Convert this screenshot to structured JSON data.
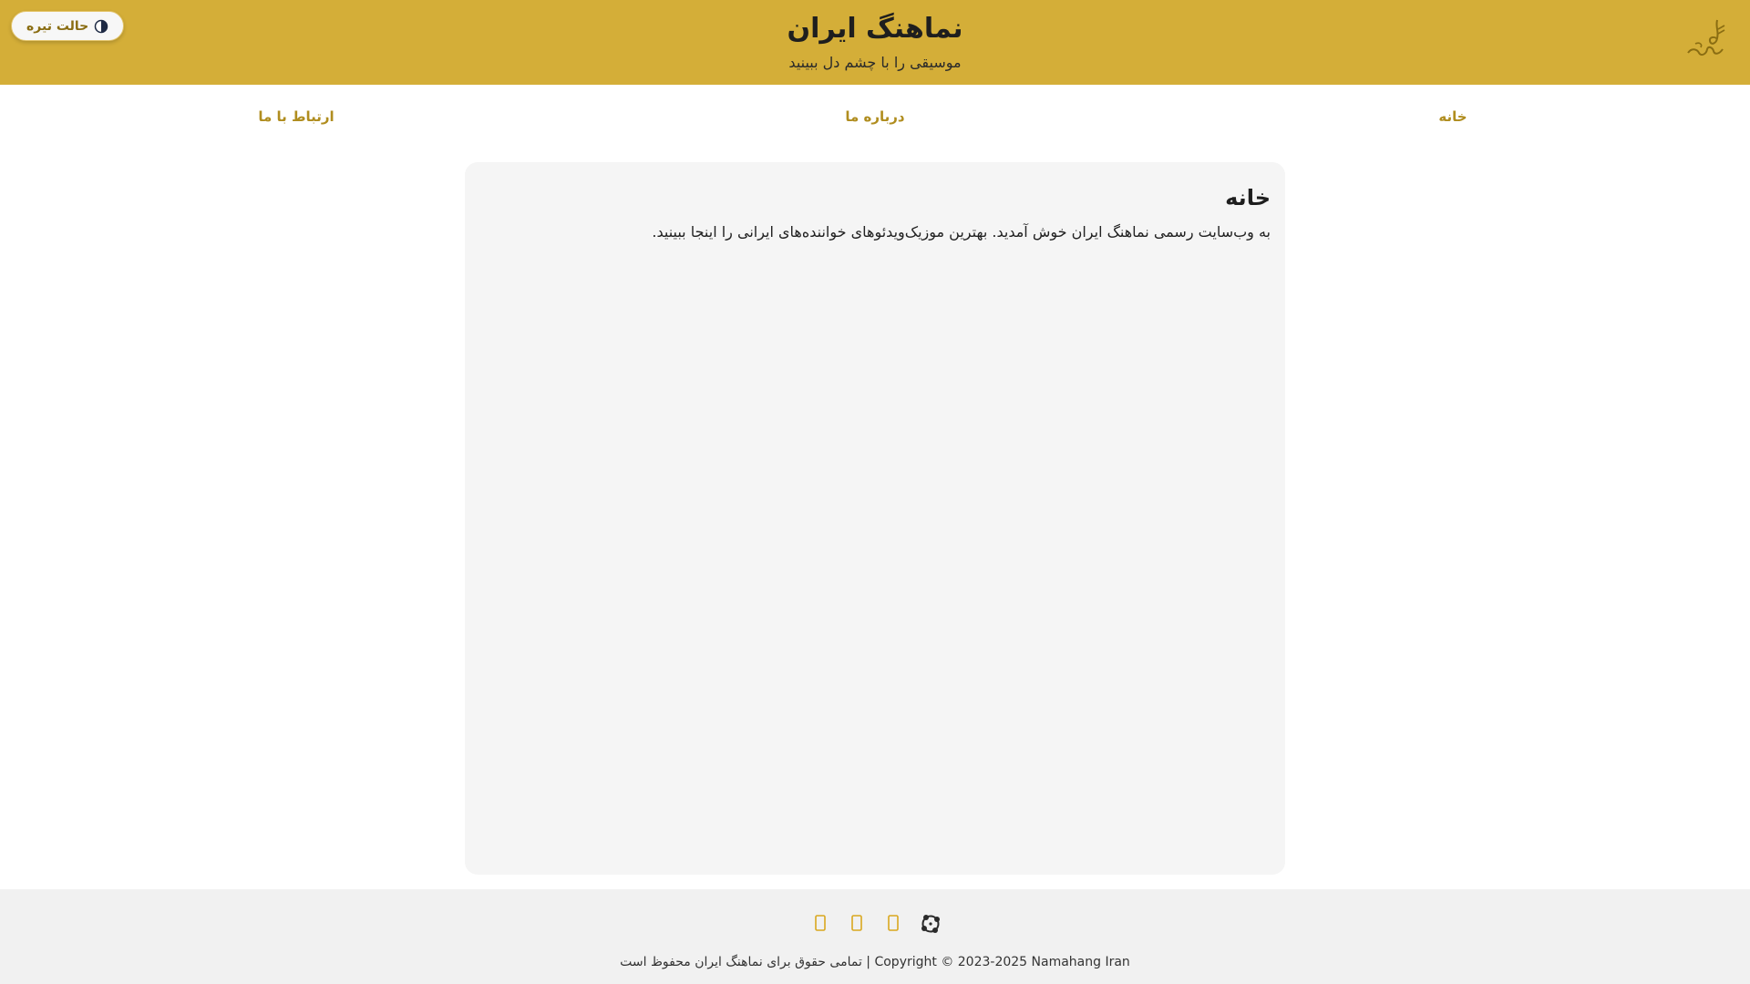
{
  "header": {
    "title": "نماهنگ ایران",
    "subtitle": "موسیقی را با چشم دل ببینید",
    "theme_toggle_label": "حالت تیره",
    "logo_icon": "music-note-calligraphy-logo-icon",
    "background_color": "#d4ae38"
  },
  "nav": {
    "items": [
      {
        "label": "خانه"
      },
      {
        "label": "درباره ما"
      },
      {
        "label": "ارتباط با ما"
      }
    ],
    "link_color": "#b08d1f"
  },
  "main": {
    "title": "خانه",
    "text": "به وب‌سایت رسمی نماهنگ ایران خوش آمدید. بهترین موزیک‌ویدئوهای خواننده‌های ایرانی را اینجا ببینید."
  },
  "footer": {
    "social_icons": [
      "generic-social-icon",
      "generic-social-icon",
      "generic-social-icon",
      "aparat-icon"
    ],
    "accent_color": "#d9a71e",
    "copyright": "Copyright © 2023-2025 Namahang Iran | تمامی حقوق برای نماهنگ ایران محفوظ است"
  }
}
